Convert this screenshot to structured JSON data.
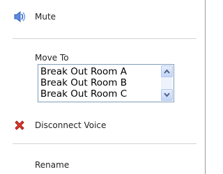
{
  "menu": {
    "mute": {
      "label": "Mute",
      "icon": "speaker-icon"
    },
    "move_to": {
      "label": "Move To",
      "rooms": [
        "Break Out Room A",
        "Break Out Room B",
        "Break Out Room C"
      ]
    },
    "disconnect": {
      "label": "Disconnect Voice",
      "icon": "red-x-icon"
    },
    "rename": {
      "label": "Rename"
    }
  },
  "colors": {
    "separator": "#d4d4d4",
    "listbox_border": "#7f9db9",
    "scroll_arrow": "#4d6185",
    "disconnect_red": "#d42a1e",
    "speaker_blue": "#3d6fd0"
  }
}
